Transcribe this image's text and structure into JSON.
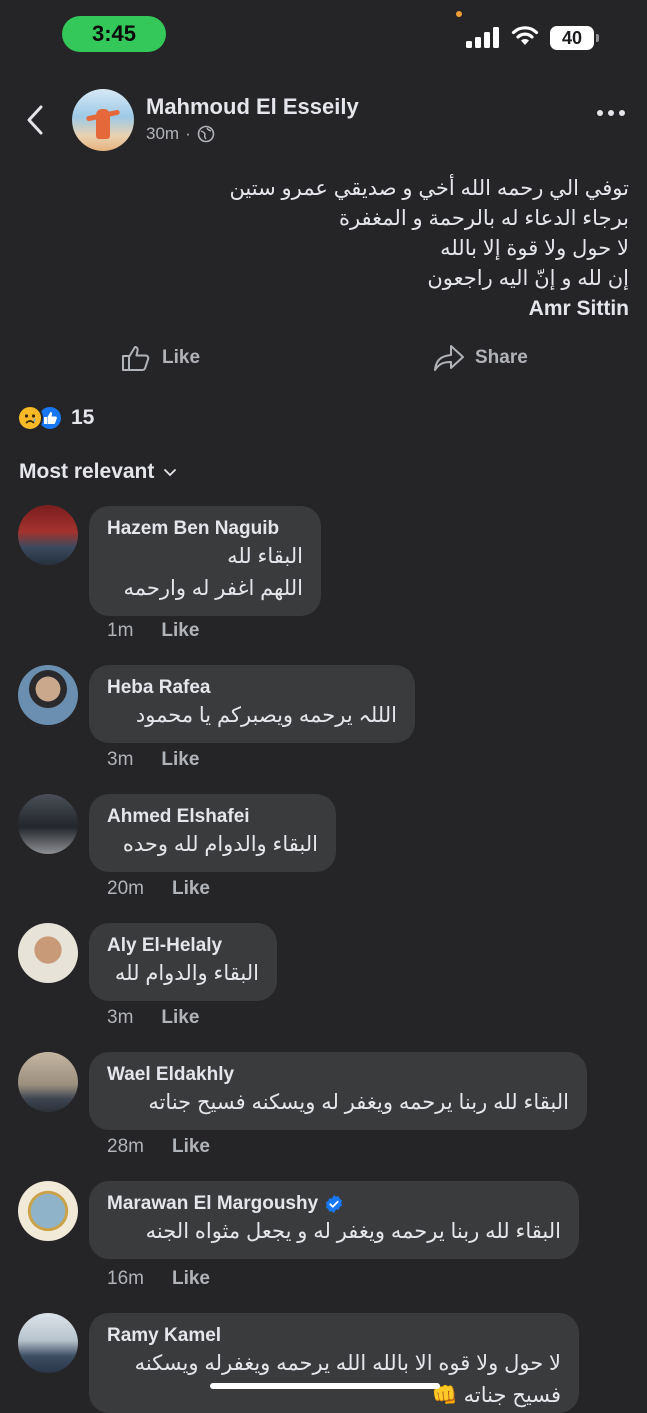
{
  "status_bar": {
    "time": "3:45",
    "battery": "40"
  },
  "post": {
    "author": "Mahmoud El Esseily",
    "age": "30m",
    "lines": [
      "توفي الي رحمه الله أخي و صديقي عمرو ستين",
      "برجاء الدعاء له بالرحمة و المغفرة",
      "لا حول ولا قوة إلا بالله",
      "إن لله و  إنّ اليه راجعون"
    ],
    "english_line": "Amr Sittin",
    "like_label": "Like",
    "share_label": "Share",
    "reaction_count": "15"
  },
  "comments_sort": "Most relevant",
  "comments": [
    {
      "name": "Hazem Ben Naguib",
      "lines": [
        "البقاء لله",
        "اللهم اغفر له وارحمه"
      ],
      "time": "1m",
      "like": "Like"
    },
    {
      "name": "Heba Rafea",
      "lines": [
        "الللہ يرحمه ويصبركم يا محمود"
      ],
      "time": "3m",
      "like": "Like"
    },
    {
      "name": "Ahmed Elshafei",
      "lines": [
        "البقاء والدوام لله وحده"
      ],
      "time": "20m",
      "like": "Like"
    },
    {
      "name": "Aly El-Helaly",
      "lines": [
        "البقاء والدوام لله"
      ],
      "time": "3m",
      "like": "Like"
    },
    {
      "name": "Wael Eldakhly",
      "lines": [
        "البقاء لله ربنا يرحمه ويغفر له ويسكنه فسيح جناته"
      ],
      "time": "28m",
      "like": "Like"
    },
    {
      "name": "Marawan El Margoushy",
      "verified": true,
      "lines": [
        "البقاء لله ربنا يرحمه ويغفر له و يجعل مثواه الجنه"
      ],
      "time": "16m",
      "like": "Like"
    },
    {
      "name": "Ramy Kamel",
      "lines": [
        "لا حول ولا قوه الا بالله الله يرحمه ويغفرله ويسكنه",
        "فسيح جناته 👊"
      ]
    }
  ],
  "colors": {
    "background": "#252527",
    "bubble": "#3a3b3c",
    "accent": "#1877f2",
    "time_pill": "#34c759"
  },
  "icons": [
    "back-chevron-icon",
    "globe-icon",
    "more-icon",
    "like-thumb-icon",
    "share-arrow-icon",
    "sad-reaction-icon",
    "like-reaction-icon",
    "chevron-down-icon",
    "verified-badge-icon"
  ]
}
